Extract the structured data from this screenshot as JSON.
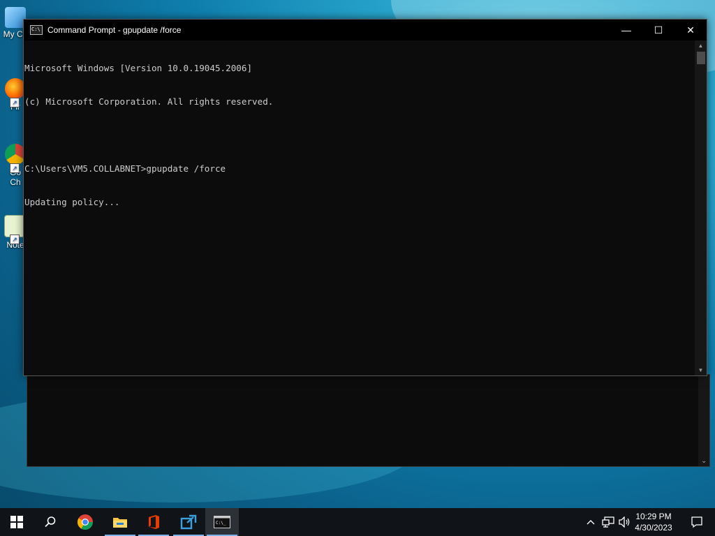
{
  "desktop": {
    "icons": [
      {
        "label": "My Co",
        "name": "this-pc"
      },
      {
        "label": "Fir",
        "name": "firefox"
      },
      {
        "label": "Go\nCh",
        "name": "google-chrome"
      },
      {
        "label": "Note",
        "name": "notepad-plus-plus"
      }
    ]
  },
  "window": {
    "title": "Command Prompt - gpupdate  /force",
    "icon": "cmd-icon",
    "controls": {
      "minimize": "—",
      "maximize": "☐",
      "close": "✕"
    }
  },
  "console": {
    "lines": [
      "Microsoft Windows [Version 10.0.19045.2006]",
      "(c) Microsoft Corporation. All rights reserved.",
      "",
      "C:\\Users\\VM5.COLLABNET>gpupdate /force",
      "Updating policy..."
    ]
  },
  "taskbar": {
    "items": [
      "start-button",
      "search-button",
      "chrome",
      "file-explorer",
      "office",
      "app-tool",
      "command-prompt"
    ],
    "clock": {
      "time": "10:29 PM",
      "date": "4/30/2023"
    },
    "colors": {
      "background": "#101418",
      "accent": "#7fb2e8"
    }
  }
}
